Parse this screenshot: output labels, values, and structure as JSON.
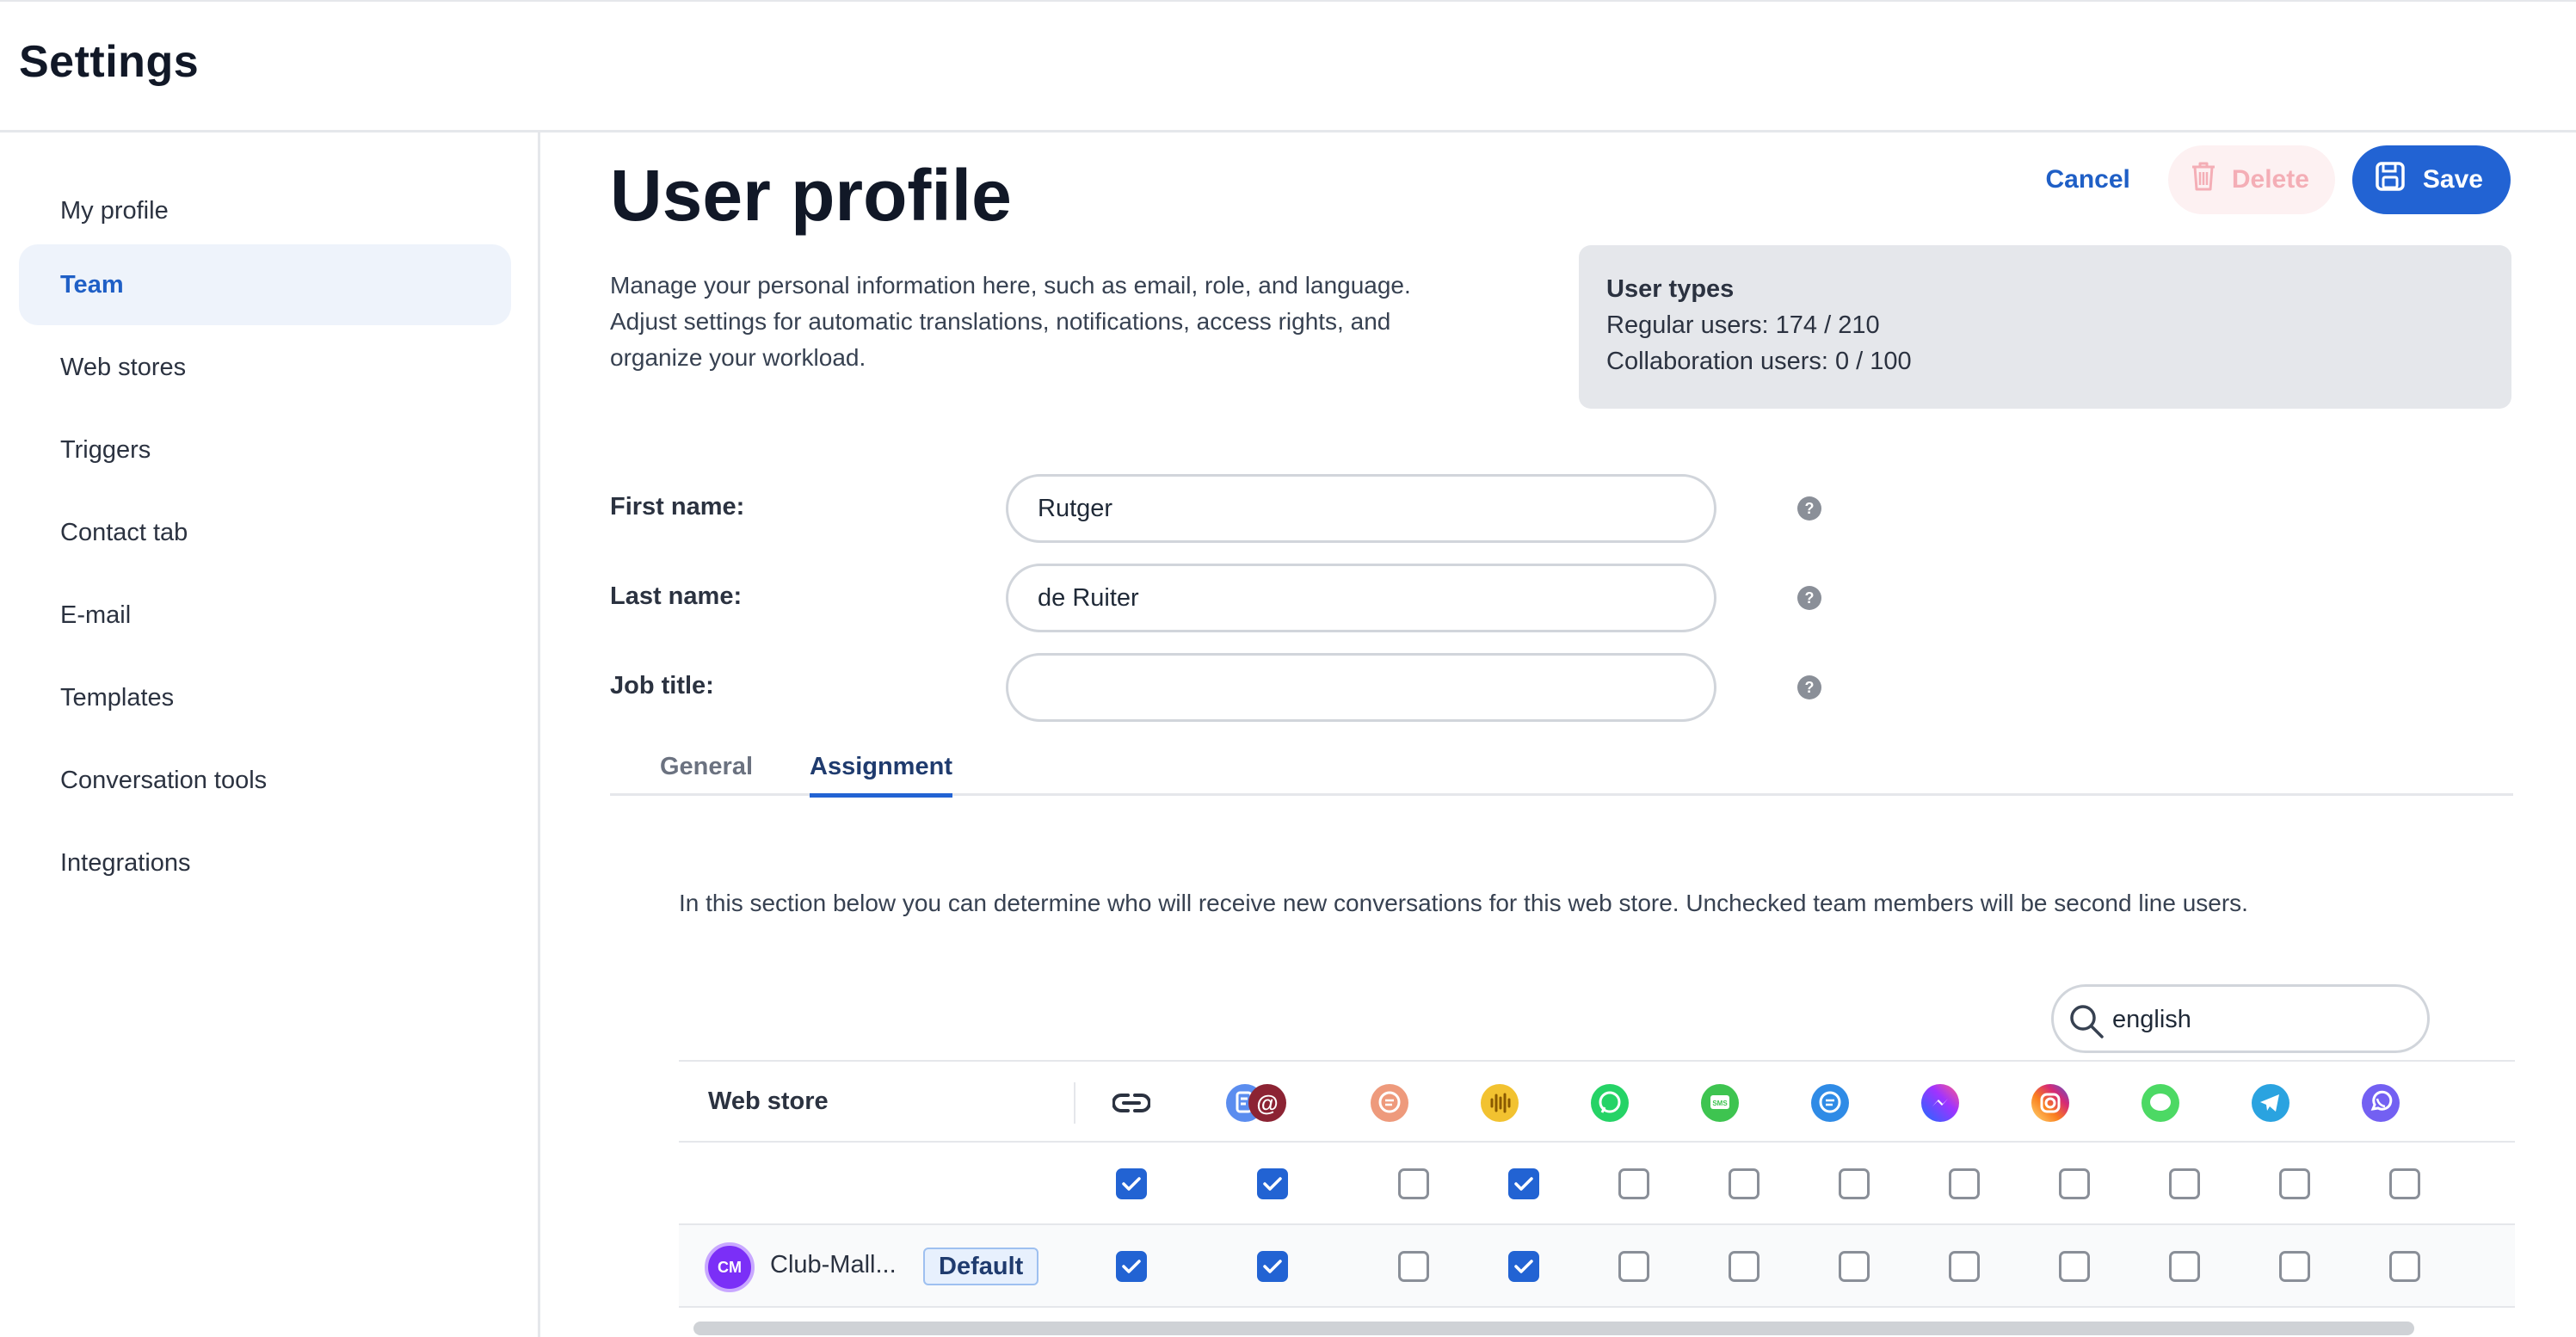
{
  "app": {
    "title": "Settings"
  },
  "sidebar": {
    "items": [
      {
        "label": "My profile",
        "active": false
      },
      {
        "label": "Team",
        "active": true
      },
      {
        "label": "Web stores",
        "active": false
      },
      {
        "label": "Triggers",
        "active": false
      },
      {
        "label": "Contact tab",
        "active": false
      },
      {
        "label": "E-mail",
        "active": false
      },
      {
        "label": "Templates",
        "active": false
      },
      {
        "label": "Conversation tools",
        "active": false
      },
      {
        "label": "Integrations",
        "active": false
      }
    ]
  },
  "header": {
    "title": "User profile",
    "cancel_label": "Cancel",
    "delete_label": "Delete",
    "save_label": "Save"
  },
  "intro": {
    "line1": "Manage your personal information here, such as email, role, and language.",
    "line2": "Adjust settings for automatic translations, notifications, access rights, and",
    "line3": "organize your workload."
  },
  "user_types": {
    "title": "User types",
    "regular": "Regular users: 174 / 210",
    "collaboration": "Collaboration users: 0 / 100"
  },
  "form": {
    "first_name_label": "First name:",
    "first_name_value": "Rutger",
    "last_name_label": "Last name:",
    "last_name_value": "de Ruiter",
    "job_title_label": "Job title:",
    "job_title_value": "",
    "help_glyph": "?"
  },
  "tabs": {
    "general": "General",
    "assignment": "Assignment",
    "active": "Assignment"
  },
  "assignment": {
    "note": "In this section below you can determine who will receive new conversations for this web store. Unchecked team members will be second line users.",
    "search_value": "english",
    "table": {
      "store_header": "Web store",
      "channel_icons": [
        "link-icon",
        "form-email-icon",
        "chat-icon",
        "voice-icon",
        "whatsapp-icon",
        "sms-icon",
        "livechat-icon",
        "messenger-icon",
        "instagram-icon",
        "imessage-icon",
        "telegram-icon",
        "viber-icon"
      ],
      "rows": [
        {
          "name": "",
          "default": "",
          "checks": [
            true,
            true,
            false,
            true,
            false,
            false,
            false,
            false,
            false,
            false,
            false,
            false
          ]
        },
        {
          "name": "Club-Mall...",
          "default": "Default",
          "logo": "CM",
          "checks": [
            true,
            true,
            false,
            true,
            false,
            false,
            false,
            false,
            false,
            false,
            false,
            false
          ]
        }
      ]
    }
  },
  "colors": {
    "accent": "#2263d3",
    "sidebar_active_bg": "#eef3fb",
    "delete_text": "#f4aeb6"
  }
}
